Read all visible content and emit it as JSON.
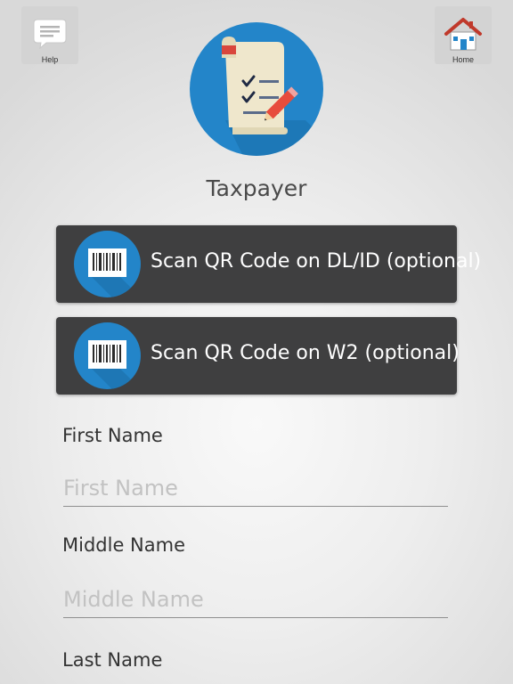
{
  "header": {
    "help_label": "Help",
    "home_label": "Home",
    "help_icon": "chat-bubble-icon",
    "home_icon": "house-icon"
  },
  "logo_icon": "checklist-scroll-pencil-icon",
  "title": "Taxpayer",
  "scan_buttons": [
    {
      "label": "Scan QR Code on DL/ID (optional)",
      "icon": "barcode-icon"
    },
    {
      "label": "Scan QR Code on W2 (optional)",
      "icon": "barcode-icon"
    }
  ],
  "fields": [
    {
      "label": "First Name",
      "placeholder": "First Name",
      "value": ""
    },
    {
      "label": "Middle Name",
      "placeholder": "Middle Name",
      "value": ""
    },
    {
      "label": "Last Name"
    }
  ],
  "colors": {
    "accent_blue": "#2385c9",
    "button_dark": "#3f3f40",
    "placeholder_gray": "#c2c2c2"
  }
}
